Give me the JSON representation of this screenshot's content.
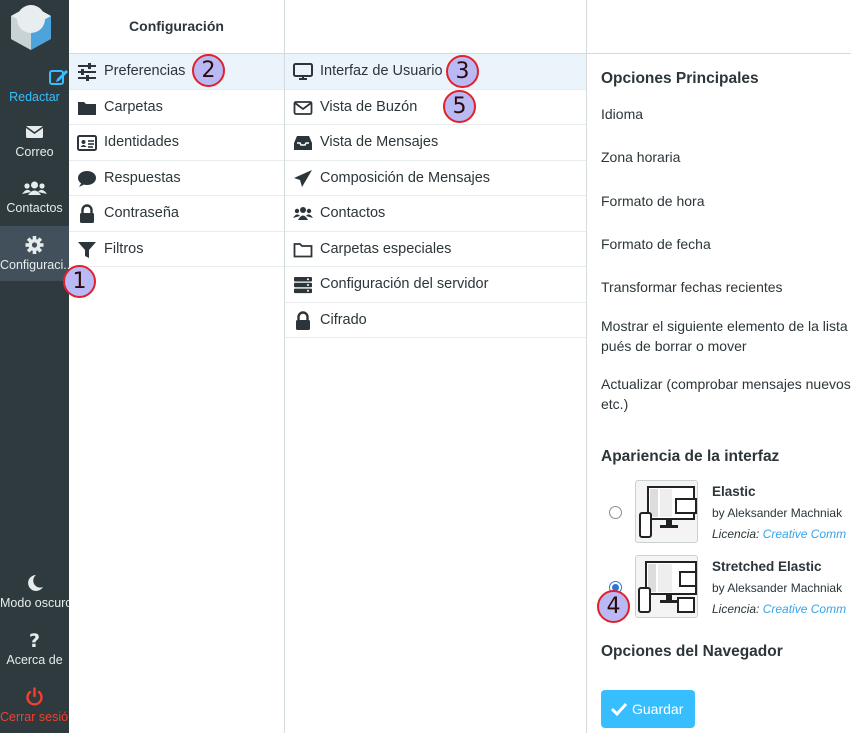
{
  "nav": {
    "items": [
      {
        "label": "Redactar",
        "icon": "compose-icon"
      },
      {
        "label": "Correo",
        "icon": "mail-icon"
      },
      {
        "label": "Contactos",
        "icon": "contacts-icon"
      },
      {
        "label": "Configuraci...",
        "icon": "gear-icon"
      }
    ],
    "bottom": [
      {
        "label": "Modo oscuro",
        "icon": "moon-icon"
      },
      {
        "label": "Acerca de",
        "icon": "question-icon"
      },
      {
        "label": "Cerrar sesión",
        "icon": "power-icon"
      }
    ]
  },
  "settings": {
    "title": "Configuración",
    "sections": [
      {
        "label": "Preferencias",
        "icon": "sliders-icon"
      },
      {
        "label": "Carpetas",
        "icon": "folder-icon"
      },
      {
        "label": "Identidades",
        "icon": "id-card-icon"
      },
      {
        "label": "Respuestas",
        "icon": "comment-icon"
      },
      {
        "label": "Contraseña",
        "icon": "lock-icon"
      },
      {
        "label": "Filtros",
        "icon": "filter-icon"
      }
    ]
  },
  "preferences": {
    "sections": [
      {
        "label": "Interfaz de Usuario",
        "icon": "monitor-icon"
      },
      {
        "label": "Vista de Buzón",
        "icon": "envelope-icon"
      },
      {
        "label": "Vista de Mensajes",
        "icon": "inbox-icon"
      },
      {
        "label": "Composición de Mensajes",
        "icon": "paper-plane-icon"
      },
      {
        "label": "Contactos",
        "icon": "users-icon"
      },
      {
        "label": "Carpetas especiales",
        "icon": "folder-outline-icon"
      },
      {
        "label": "Configuración del servidor",
        "icon": "server-icon"
      },
      {
        "label": "Cifrado",
        "icon": "lock-icon"
      }
    ]
  },
  "detail": {
    "main_title": "Opciones Principales",
    "options": [
      "Idioma",
      "Zona horaria",
      "Formato de hora",
      "Formato de fecha",
      "Transformar fechas recientes",
      "Mostrar el siguiente elemento de la lista",
      "pués de borrar o mover",
      "Actualizar (comprobar mensajes nuevos",
      "etc.)"
    ],
    "appearance_title": "Apariencia de la interfaz",
    "skins": [
      {
        "name": "Elastic",
        "author": "by Aleksander Machniak",
        "license_label": "Licencia:",
        "license_link": "Creative Comm",
        "selected": false
      },
      {
        "name": "Stretched Elastic",
        "author": "by Aleksander Machniak",
        "license_label": "Licencia:",
        "license_link": "Creative Comm",
        "selected": true
      }
    ],
    "browser_title": "Opciones del Navegador",
    "save_label": "Guardar"
  },
  "annotations": [
    "1",
    "2",
    "3",
    "4",
    "5"
  ],
  "colors": {
    "nav_bg": "#2f3a3f",
    "accent": "#37beff",
    "logout": "#f2412c",
    "selected_row": "#ebf3fb",
    "mark_border": "#e0212a"
  }
}
